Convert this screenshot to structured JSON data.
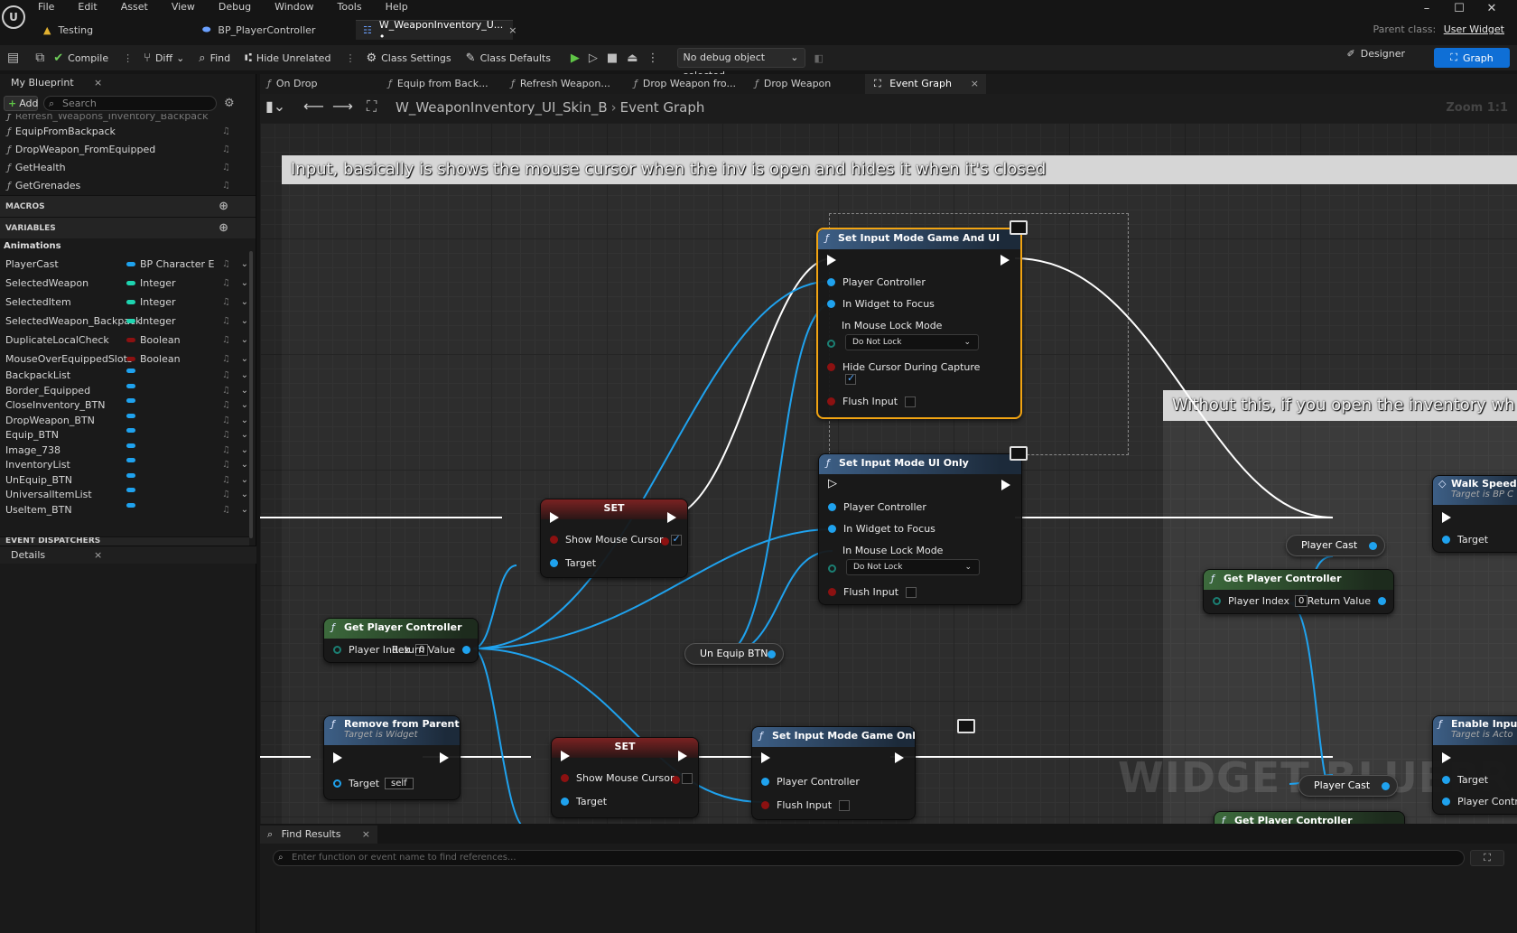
{
  "window": {
    "menu": [
      "File",
      "Edit",
      "Asset",
      "View",
      "Debug",
      "Window",
      "Tools",
      "Help"
    ],
    "tabs": [
      {
        "label": "Testing",
        "icon": "warning-icon"
      },
      {
        "label": "BP_PlayerController",
        "icon": "blueprint-icon"
      },
      {
        "label": "W_WeaponInventory_U... •",
        "icon": "widget-icon",
        "active": true
      }
    ],
    "tab_close": "×",
    "controls": [
      "–",
      "☐",
      "✕"
    ],
    "parent_class_label": "Parent class:",
    "parent_class_value": "User Widget"
  },
  "toolbar": {
    "compile": "Compile",
    "diff": "Diff",
    "find": "Find",
    "hide_unrelated": "Hide Unrelated",
    "class_settings": "Class Settings",
    "class_defaults": "Class Defaults",
    "debug_object": "No debug object selected",
    "designer": "Designer",
    "graph": "Graph"
  },
  "my_blueprint": {
    "tab_label": "My Blueprint",
    "add_label": "Add",
    "search_placeholder": "Search",
    "functions": [
      "Refresh_Weapons_Inventory_Backpack",
      "EquipFromBackpack",
      "DropWeapon_FromEquipped",
      "GetHealth",
      "GetGrenades"
    ],
    "macros_label": "MACROS",
    "variables_label": "VARIABLES",
    "category": "Animations",
    "variables": [
      {
        "name": "PlayerCast",
        "type": "BP Character E",
        "color": "#1fa2ee"
      },
      {
        "name": "SelectedWeapon",
        "type": "Integer",
        "color": "#1ed4b0"
      },
      {
        "name": "SelectedItem",
        "type": "Integer",
        "color": "#1ed4b0"
      },
      {
        "name": "SelectedWeapon_Backpack",
        "type": "Integer",
        "color": "#1ed4b0"
      },
      {
        "name": "DuplicateLocalCheck",
        "type": "Boolean",
        "color": "#8c1111"
      },
      {
        "name": "MouseOverEquippedSlots",
        "type": "Boolean",
        "color": "#8c1111"
      },
      {
        "name": "BackpackList",
        "type": "",
        "color": "#1fa2ee"
      },
      {
        "name": "Border_Equipped",
        "type": "",
        "color": "#1fa2ee"
      },
      {
        "name": "CloseInventory_BTN",
        "type": "",
        "color": "#1fa2ee"
      },
      {
        "name": "DropWeapon_BTN",
        "type": "",
        "color": "#1fa2ee"
      },
      {
        "name": "Equip_BTN",
        "type": "",
        "color": "#1fa2ee"
      },
      {
        "name": "Image_738",
        "type": "",
        "color": "#1fa2ee"
      },
      {
        "name": "InventoryList",
        "type": "",
        "color": "#1fa2ee"
      },
      {
        "name": "UnEquip_BTN",
        "type": "",
        "color": "#1fa2ee"
      },
      {
        "name": "UniversalItemList",
        "type": "",
        "color": "#1fa2ee"
      },
      {
        "name": "UseItem_BTN",
        "type": "",
        "color": "#1fa2ee"
      }
    ],
    "event_dispatchers_label": "EVENT DISPATCHERS"
  },
  "details": {
    "tab_label": "Details"
  },
  "graph_tabs": [
    {
      "label": "On Drop"
    },
    {
      "label": "Equip from Back..."
    },
    {
      "label": "Refresh Weapon..."
    },
    {
      "label": "Drop Weapon fro..."
    },
    {
      "label": "Drop Weapon"
    },
    {
      "label": "Event Graph",
      "active": true
    }
  ],
  "breadcrumb": {
    "blueprint": "W_WeaponInventory_UI_Skin_B",
    "graph": "Event Graph",
    "zoom": "Zoom 1:1"
  },
  "graph": {
    "comment_main": "Input, basically is shows the mouse cursor when the inv is open and hides it when it's closed",
    "comment_right": "Without this, if you open the inventory wh",
    "watermark": "WIDGET BLUEPRINT",
    "nodes": {
      "set_input_game_ui": {
        "title": "Set Input Mode Game And UI",
        "pins": [
          "Player Controller",
          "In Widget to Focus",
          "In Mouse Lock Mode",
          "Hide Cursor During Capture",
          "Flush Input"
        ],
        "lock_mode": "Do Not Lock",
        "hide_cursor_checked": true
      },
      "set_input_ui_only": {
        "title": "Set Input Mode UI Only",
        "pins": [
          "Player Controller",
          "In Widget to Focus",
          "In Mouse Lock Mode",
          "Flush Input"
        ],
        "lock_mode": "Do Not Lock"
      },
      "set_input_game_only": {
        "title": "Set Input Mode Game Only",
        "pins": [
          "Player Controller",
          "Flush Input"
        ]
      },
      "set_show_cursor_on": {
        "title": "SET",
        "pins": [
          "Show Mouse Cursor",
          "Target"
        ],
        "checked": true
      },
      "set_show_cursor_off": {
        "title": "SET",
        "pins": [
          "Show Mouse Cursor",
          "Target"
        ],
        "checked": false
      },
      "get_player_controller": {
        "title": "Get Player Controller",
        "player_index_label": "Player Index",
        "player_index": "0",
        "return_label": "Return Value"
      },
      "get_player_controller_right": {
        "title": "Get Player Controller",
        "player_index_label": "Player Index",
        "player_index": "0",
        "return_label": "Return Value"
      },
      "get_player_controller_bottom": {
        "title": "Get Player Controller"
      },
      "remove_from_parent": {
        "title": "Remove from Parent",
        "subtitle": "Target is Widget",
        "target_label": "Target",
        "target_value": "self"
      },
      "un_equip_btn": {
        "label": "Un Equip BTN"
      },
      "player_cast_1": {
        "label": "Player Cast"
      },
      "player_cast_2": {
        "label": "Player Cast"
      },
      "walk_speed": {
        "title": "Walk Speed",
        "subtitle": "Target is BP C",
        "target_label": "Target"
      },
      "enable_input": {
        "title": "Enable Input",
        "subtitle": "Target is Acto",
        "target_label": "Target",
        "pc_label": "Player Contro"
      }
    }
  },
  "find_results": {
    "tab_label": "Find Results",
    "placeholder": "Enter function or event name to find references..."
  }
}
